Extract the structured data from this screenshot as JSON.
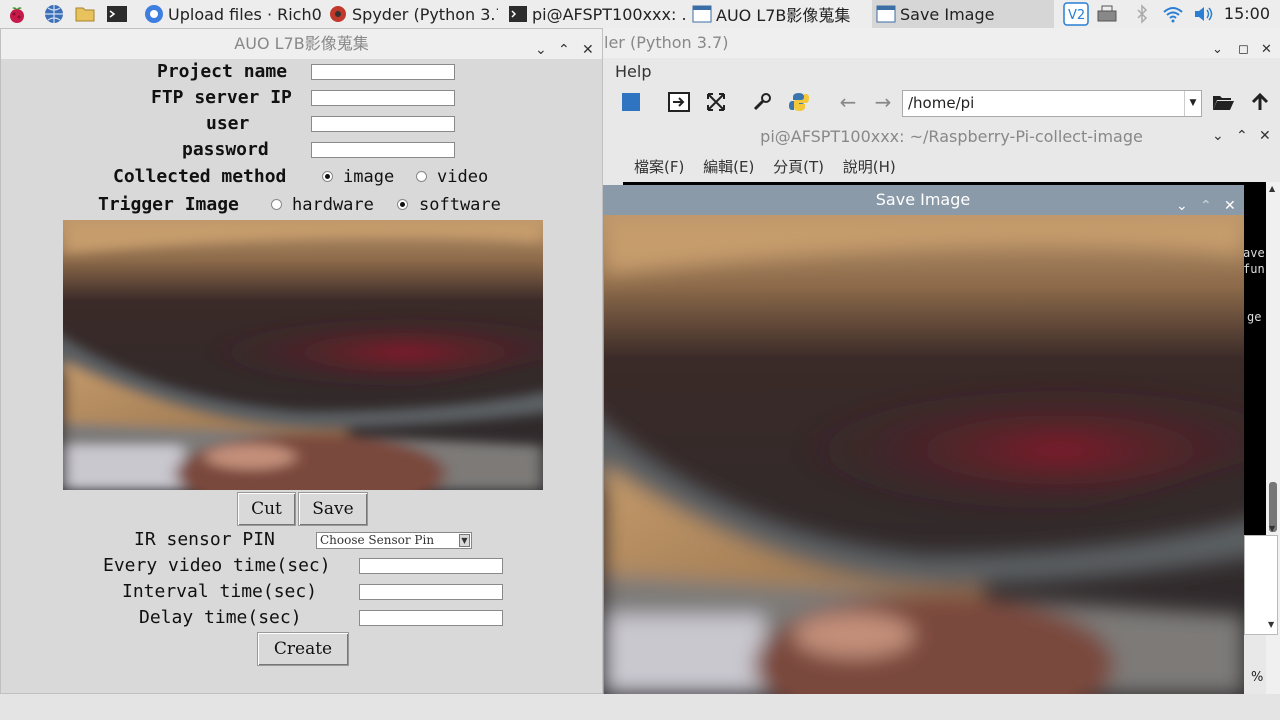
{
  "taskbar": {
    "tasks": [
      {
        "label": "Upload files · Rich0..."
      },
      {
        "label": "Spyder (Python 3.7)"
      },
      {
        "label": "pi@AFSPT100xxx: ..."
      },
      {
        "label": "AUO L7B影像蒐集"
      },
      {
        "label": "Save Image"
      }
    ],
    "clock": "15:00"
  },
  "spyder": {
    "title": "ler (Python 3.7)",
    "menu_help": "Help",
    "path": "/home/pi"
  },
  "terminal": {
    "title": "pi@AFSPT100xxx: ~/Raspberry-Pi-collect-image",
    "menu": [
      "檔案(F)",
      "編輯(E)",
      "分頁(T)",
      "說明(H)"
    ],
    "edge_text": [
      "ave",
      "fun",
      "ge"
    ],
    "pct": "%"
  },
  "save_window": {
    "title": "Save Image"
  },
  "main_window": {
    "title": "AUO L7B影像蒐集",
    "project_name_label": "Project name",
    "ftp_label": "FTP server IP",
    "user_label": "user",
    "password_label": "password",
    "collect_label": "Collected method",
    "collect_options": [
      "image",
      "video"
    ],
    "collect_selected": "image",
    "trigger_label": "Trigger Image",
    "trigger_options": [
      "hardware",
      "software"
    ],
    "trigger_selected": "software",
    "cut_button": "Cut",
    "save_button": "Save",
    "ir_label": "IR sensor PIN",
    "ir_select": "Choose Sensor Pin",
    "video_time_label": "Every video time(sec)",
    "interval_label": "Interval time(sec)",
    "delay_label": "Delay time(sec)",
    "create_button": "Create"
  }
}
